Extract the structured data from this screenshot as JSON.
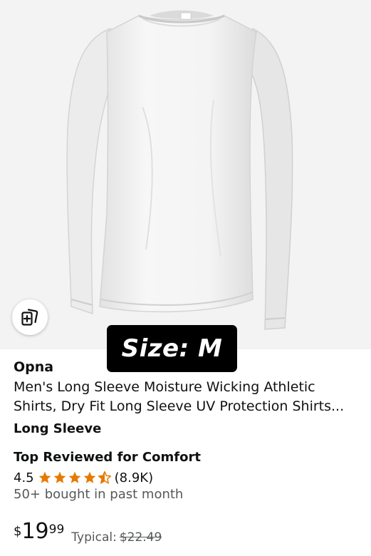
{
  "product": {
    "image_alt": "white long sleeve shirt",
    "size_badge": "Size: M",
    "brand": "Opna",
    "title_line1": "Men's Long Sleeve Moisture Wicking Athletic",
    "title_line2": "Shirts, Dry Fit Long Sleeve UV Protection Shirts...",
    "variant": "Long Sleeve",
    "badge": "Top Reviewed for Comfort",
    "rating": {
      "value": "4.5",
      "stars": 4.5,
      "count": "(8.9K)"
    },
    "bought": "50+ bought in past month",
    "price": {
      "currency": "$",
      "whole": "19",
      "fraction": "99",
      "typical_label": "Typical:",
      "typical_price": "$22.49"
    }
  },
  "icons": {
    "compare": "compare-icon",
    "star": "star-icon"
  },
  "colors": {
    "star": "#e67a00",
    "badge_bg": "#000000",
    "muted_text": "#565959"
  }
}
